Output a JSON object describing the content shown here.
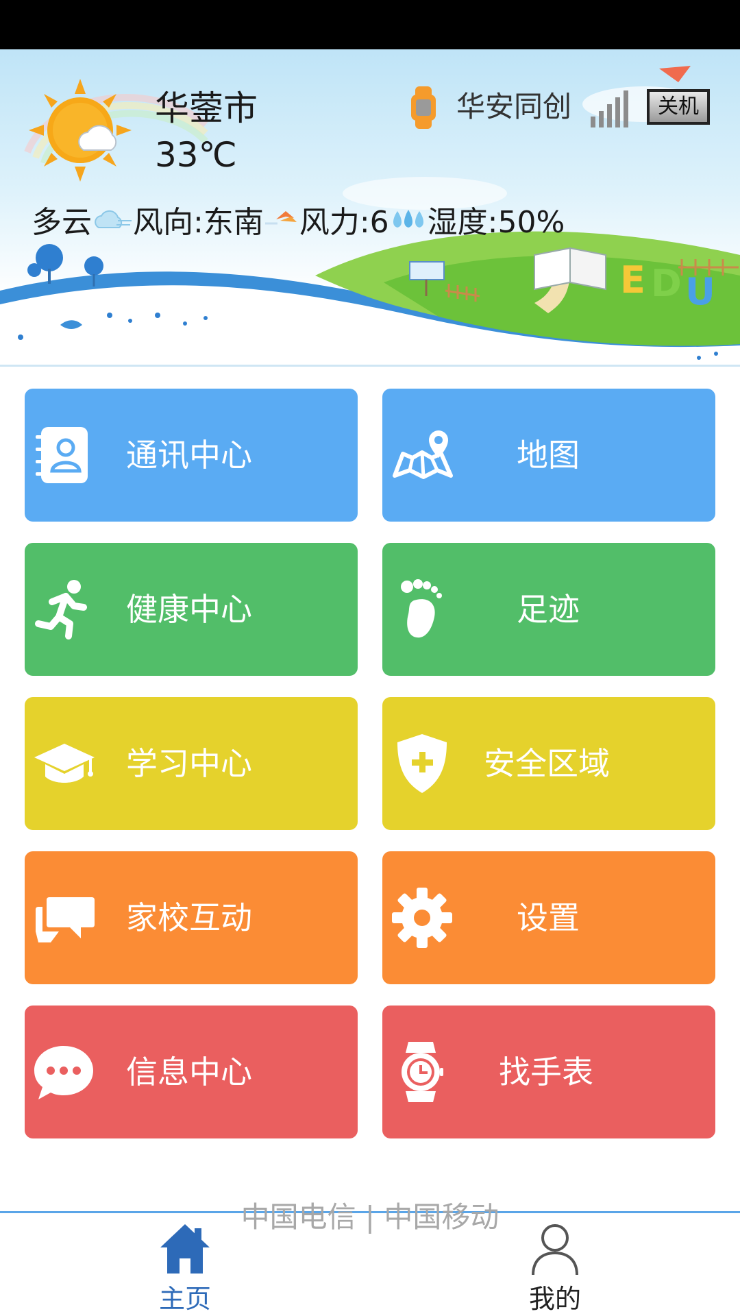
{
  "colors": {
    "blue": "#5aabf3",
    "green": "#52be69",
    "yellow": "#e5d22c",
    "orange": "#fb8c35",
    "red": "#ea5f5f",
    "tab_active": "#2d6ab8",
    "tab_inactive": "#222222"
  },
  "weather": {
    "city": "华蓥市",
    "temperature": "33℃",
    "condition": "多云",
    "wind_direction": "风向:东南",
    "wind_force": "风力:6",
    "humidity": "湿度:50%",
    "icon": "sun-cloud-icon"
  },
  "device": {
    "name": "华安同创",
    "shutdown_label": "关机",
    "icon": "watch-icon"
  },
  "grid": {
    "tiles": [
      {
        "label": "通讯中心",
        "icon": "contacts-icon"
      },
      {
        "label": "地图",
        "icon": "map-icon"
      },
      {
        "label": "健康中心",
        "icon": "running-icon"
      },
      {
        "label": "足迹",
        "icon": "footprint-icon"
      },
      {
        "label": "学习中心",
        "icon": "graduation-cap-icon"
      },
      {
        "label": "安全区域",
        "icon": "shield-icon"
      },
      {
        "label": "家校互动",
        "icon": "chat-bubbles-icon"
      },
      {
        "label": "设置",
        "icon": "gear-icon"
      },
      {
        "label": "信息中心",
        "icon": "message-icon"
      },
      {
        "label": "找手表",
        "icon": "watch-clock-icon"
      }
    ]
  },
  "footer": {
    "carriers": "中国电信 | 中国移动"
  },
  "tabbar": {
    "tabs": [
      {
        "label": "主页",
        "icon": "home-icon",
        "active": true
      },
      {
        "label": "我的",
        "icon": "user-icon",
        "active": false
      }
    ]
  }
}
